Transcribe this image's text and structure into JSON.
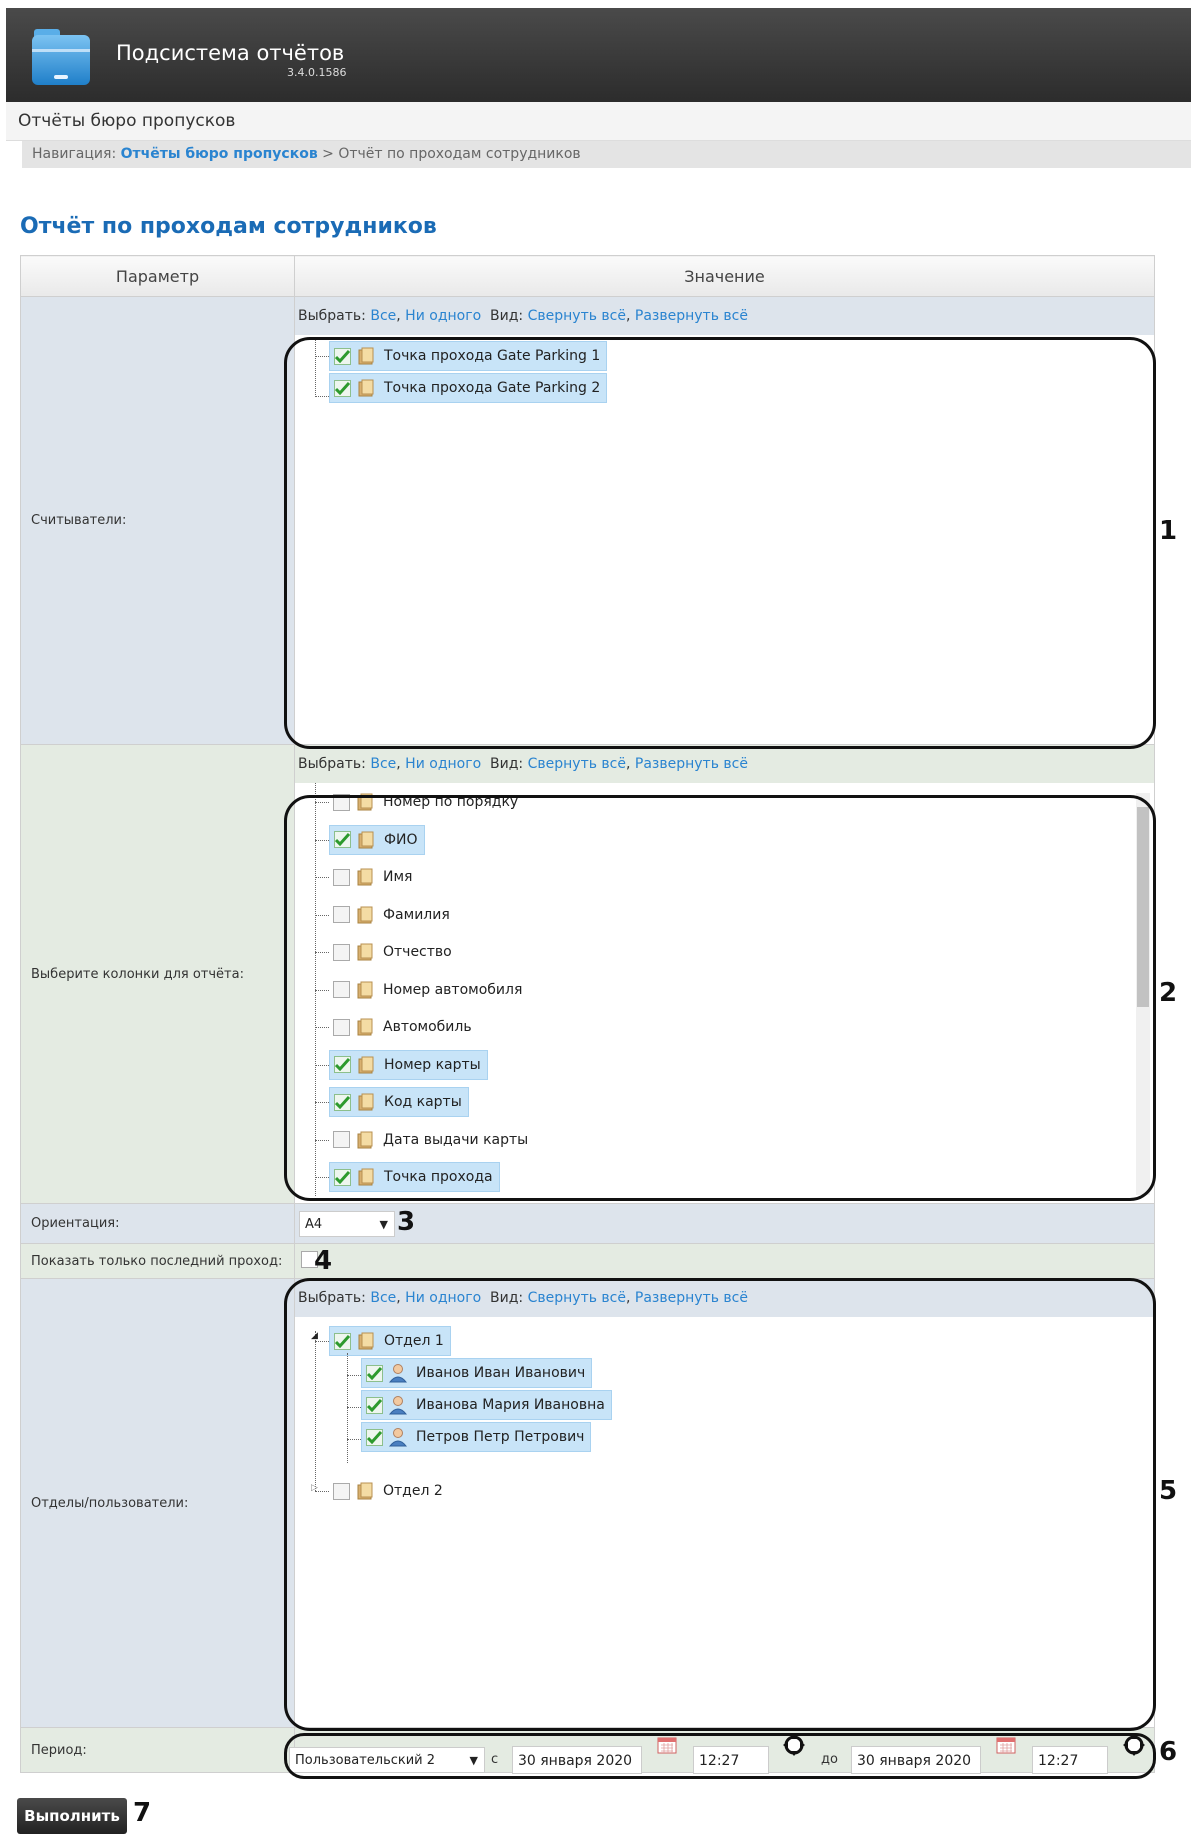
{
  "app": {
    "title": "Подсистема отчётов",
    "version": "3.4.0.1586"
  },
  "subbar": {
    "title": "Отчёты бюро пропусков"
  },
  "breadcrumb": {
    "prefix": "Навигация:",
    "link": "Отчёты бюро пропусков",
    "separator": ">",
    "current": "Отчёт по проходам сотрудников"
  },
  "page": {
    "title": "Отчёт по проходам сотрудников"
  },
  "table": {
    "col_param": "Параметр",
    "col_value": "Значение"
  },
  "selector": {
    "choose": "Выбрать:",
    "all": "Все",
    "none": "Ни одного",
    "view": "Вид:",
    "collapse": "Свернуть всё",
    "expand": "Развернуть всё"
  },
  "readers": {
    "label": "Считыватели:",
    "items": [
      {
        "label": "Точка прохода Gate Parking 1",
        "checked": true
      },
      {
        "label": "Точка прохода Gate Parking 2",
        "checked": true
      }
    ]
  },
  "columns": {
    "label": "Выберите колонки для отчёта:",
    "items": [
      {
        "label": "Номер по порядку",
        "checked": false
      },
      {
        "label": "ФИО",
        "checked": true
      },
      {
        "label": "Имя",
        "checked": false
      },
      {
        "label": "Фамилия",
        "checked": false
      },
      {
        "label": "Отчество",
        "checked": false
      },
      {
        "label": "Номер автомобиля",
        "checked": false
      },
      {
        "label": "Автомобиль",
        "checked": false
      },
      {
        "label": "Номер карты",
        "checked": true
      },
      {
        "label": "Код карты",
        "checked": true
      },
      {
        "label": "Дата выдачи карты",
        "checked": false
      },
      {
        "label": "Точка прохода",
        "checked": true
      }
    ]
  },
  "orientation": {
    "label": "Ориентация:",
    "value": "A4"
  },
  "last_pass": {
    "label": "Показать только последний проход:",
    "checked": false
  },
  "departments": {
    "label": "Отделы/пользователи:",
    "dept1": "Отдел 1",
    "users": [
      "Иванов Иван Иванович",
      "Иванова Мария Ивановна",
      "Петров Петр Петрович"
    ],
    "dept2": "Отдел 2"
  },
  "period": {
    "label": "Период:",
    "preset": "Пользовательский 2",
    "from_label": "с",
    "from_date": "30 января 2020",
    "from_time": "12:27",
    "to_label": "до",
    "to_date": "30 января 2020",
    "to_time": "12:27"
  },
  "run_button": "Выполнить",
  "callouts": [
    "1",
    "2",
    "3",
    "4",
    "5",
    "6",
    "7"
  ],
  "colors": {
    "link": "#2a84d0",
    "title": "#1a6bb5",
    "selected_bg": "#c8e4f8",
    "header_bg": "#2c2c2c"
  }
}
